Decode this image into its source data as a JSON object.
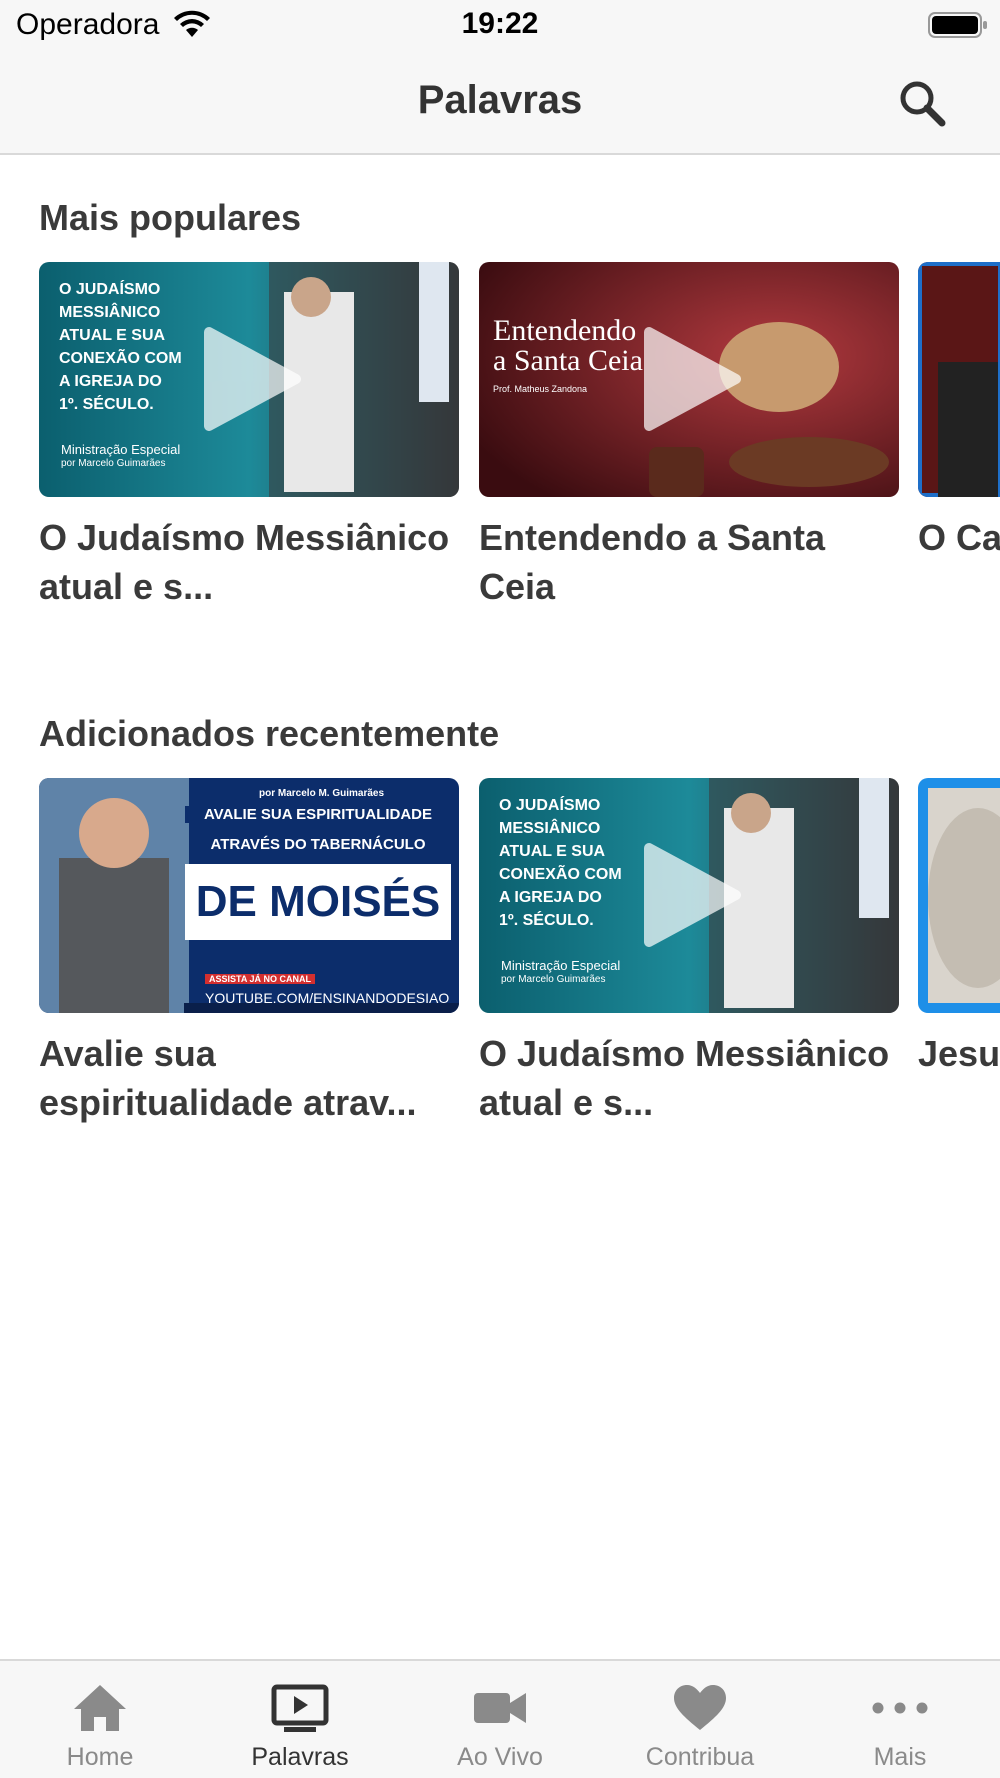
{
  "status_bar": {
    "carrier": "Operadora",
    "time": "19:22"
  },
  "nav": {
    "title": "Palavras",
    "search_icon": "search-icon"
  },
  "sections": [
    {
      "title": "Mais populares",
      "cards": [
        {
          "title": "O Judaísmo Messiânico atual e s...",
          "thumb_text": [
            "O JUDAÍSMO",
            "MESSIÂNICO",
            "ATUAL E SUA",
            "CONEXÃO COM",
            "A IGREJA DO",
            "1º. SÉCULO."
          ],
          "thumb_sub": "Ministração Especial",
          "thumb_sub2": "por Marcelo Guimarães"
        },
        {
          "title": "Entendendo a Santa Ceia",
          "thumb_text": [
            "Entendendo",
            "a Santa Ceia"
          ],
          "thumb_sub": "Prof. Matheus Zandona"
        },
        {
          "title": "O Ca... ÁRV..."
        }
      ]
    },
    {
      "title": "Adicionados recentemente",
      "cards": [
        {
          "title": "Avalie sua espiritualidade atrav...",
          "thumb_top": "por Marcelo M. Guimarães",
          "thumb_text": [
            "AVALIE SUA ESPIRITUALIDADE",
            "ATRAVÉS DO TABERNÁCULO",
            "DE MOISÉS"
          ],
          "thumb_sub": "ASSISTA JÁ NO CANAL",
          "thumb_sub2": "YOUTUBE.COM/ENSINANDODESIAO"
        },
        {
          "title": "O Judaísmo Messiânico atual e s...",
          "thumb_text": [
            "O JUDAÍSMO",
            "MESSIÂNICO",
            "ATUAL E SUA",
            "CONEXÃO COM",
            "A IGREJA DO",
            "1º. SÉCULO."
          ],
          "thumb_sub": "Ministração Especial",
          "thumb_sub2": "por Marcelo Guimarães"
        },
        {
          "title": "Jesu... de D..."
        }
      ]
    }
  ],
  "tabs": [
    {
      "label": "Home",
      "icon": "home-icon",
      "active": false
    },
    {
      "label": "Palavras",
      "icon": "tv-play-icon",
      "active": true
    },
    {
      "label": "Ao Vivo",
      "icon": "video-camera-icon",
      "active": false
    },
    {
      "label": "Contribua",
      "icon": "heart-icon",
      "active": false
    },
    {
      "label": "Mais",
      "icon": "more-dots-icon",
      "active": false
    }
  ],
  "colors": {
    "accent": "#333333",
    "inactive": "#8a8a8a",
    "bar_bg": "#f7f7f7"
  }
}
